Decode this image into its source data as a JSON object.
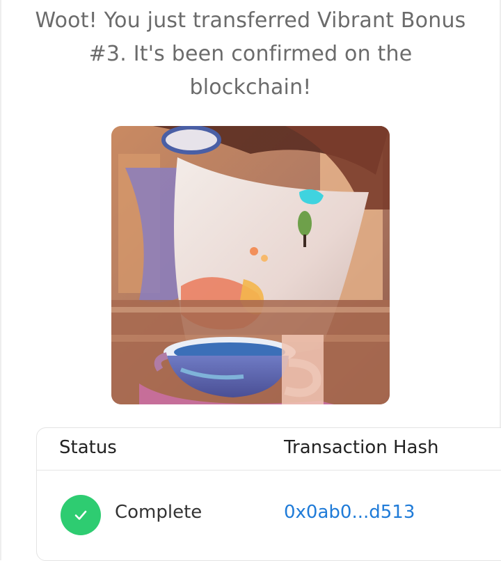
{
  "headline": "Woot! You just transferred Vibrant Bonus #3. It's been confirmed on the blockchain!",
  "nft": {
    "name": "Vibrant Bonus #3"
  },
  "table": {
    "headers": {
      "status": "Status",
      "hash": "Transaction Hash"
    },
    "row": {
      "status": "Complete",
      "hash": "0x0ab0...d513",
      "status_icon": "check-icon"
    }
  },
  "colors": {
    "headline_text": "#6b6b6b",
    "success_green": "#2ecc71",
    "link_blue": "#1f7bd8",
    "border": "#e3e3e3"
  }
}
